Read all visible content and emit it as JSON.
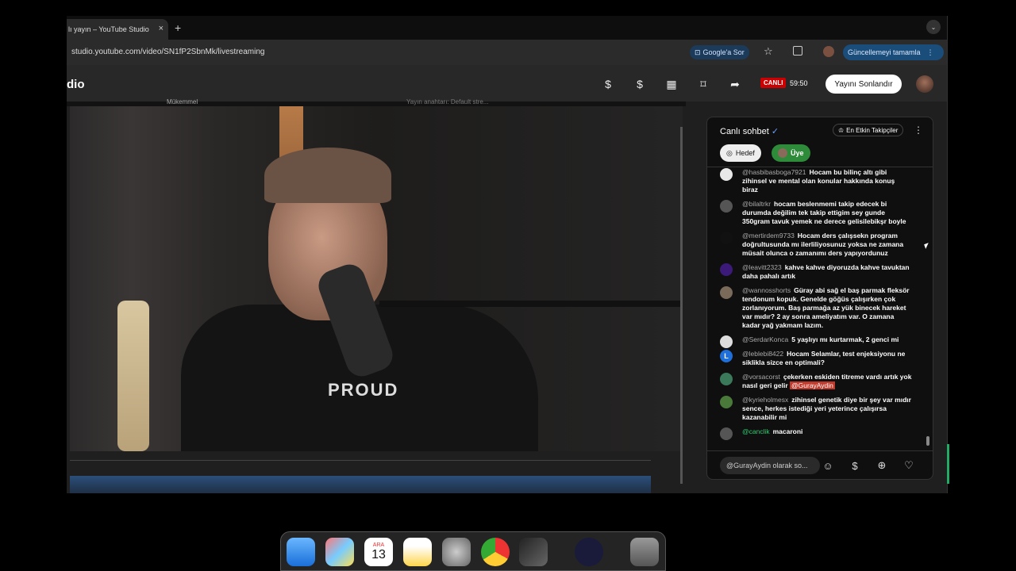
{
  "browser": {
    "tab_title": "lı yayın – YouTube Studio",
    "tab_close": "×",
    "new_tab": "+",
    "url": "studio.youtube.com/video/SN1fP2SbnMk/livestreaming",
    "google_ask": "Google'a Sor",
    "update_label": "Güncellemeyi tamamla"
  },
  "studio": {
    "logo": "dio",
    "live_badge": "CANLI",
    "elapsed": "59:50",
    "end_stream": "Yayını Sonlandır",
    "status_text": "Mükemmel",
    "stream_key": "Yayın anahtarı: Default stre..."
  },
  "chat": {
    "title": "Canlı sohbet",
    "top_fans": "En Etkin Takipçiler",
    "chip_goal": "Hedef",
    "chip_member": "Üye",
    "input_placeholder": "@GurayAydin olarak so...",
    "messages": [
      {
        "author": "@hasbibasboga7921",
        "text": "Hocam bu bilinç altı gibi zihinsel ve mental olan konular hakkında konuş biraz",
        "color": "#e8e8e8"
      },
      {
        "author": "@bilaltrkr",
        "text": "hocam beslenmemi takip edecek bi durumda değilim tek takip ettigim sey gunde 350gram tavuk yemek ne derece gelisilebikşr boyle",
        "color": "#555"
      },
      {
        "author": "@mertirdem9733",
        "text": "Hocam ders çalışsekn program doğrultusunda mı ilerliliyosunuz yoksa ne zamana müsait olunca o zamanımı ders yapıyordunuz",
        "color": "#111"
      },
      {
        "author": "@leavitt2323",
        "text": "kahve kahve diyoruzda kahve tavuktan daha pahalı artık",
        "color": "#3b1a7a"
      },
      {
        "author": "@wannosshorts",
        "text": "Güray abi sağ el baş parmak fleksör tendonum kopuk. Genelde göğüs çalışırken çok zorlanıyorum. Baş parmağa az yük binecek hareket var mıdır? 2 ay sonra ameliyatım var. O zamana kadar yağ yakmam lazım.",
        "color": "#7a6a5a"
      },
      {
        "author": "@SerdarKonca",
        "text": "5 yaşlıyı mı kurtarmak, 2 genci mi",
        "color": "#ddd"
      },
      {
        "author": "@leblebi8422",
        "text": "Hocam Selamlar, test enjeksiyonu ne siklikla sizce en optimali?",
        "color": "#1e6fd9",
        "initial": "L"
      },
      {
        "author": "@vorsacorst",
        "text": "çekerken eskiden titreme vardı artık yok nasıl geri gelir",
        "mention": "@GurayAydin",
        "color": "#3a7a5a"
      },
      {
        "author": "@kyrieholmesx",
        "text": "zihinsel genetik diye bir şey var mıdır sence, herkes istediği yeri yeterince çalışırsa kazanabilir mi",
        "color": "#4a7a3a"
      },
      {
        "author": "@canclik",
        "text": "macaroni",
        "color": "#555",
        "author_color": "#2ecc71"
      }
    ]
  },
  "video": {
    "shirt_text": "PROUD"
  },
  "dock": {
    "calendar_month": "ARA",
    "calendar_day": "13"
  }
}
